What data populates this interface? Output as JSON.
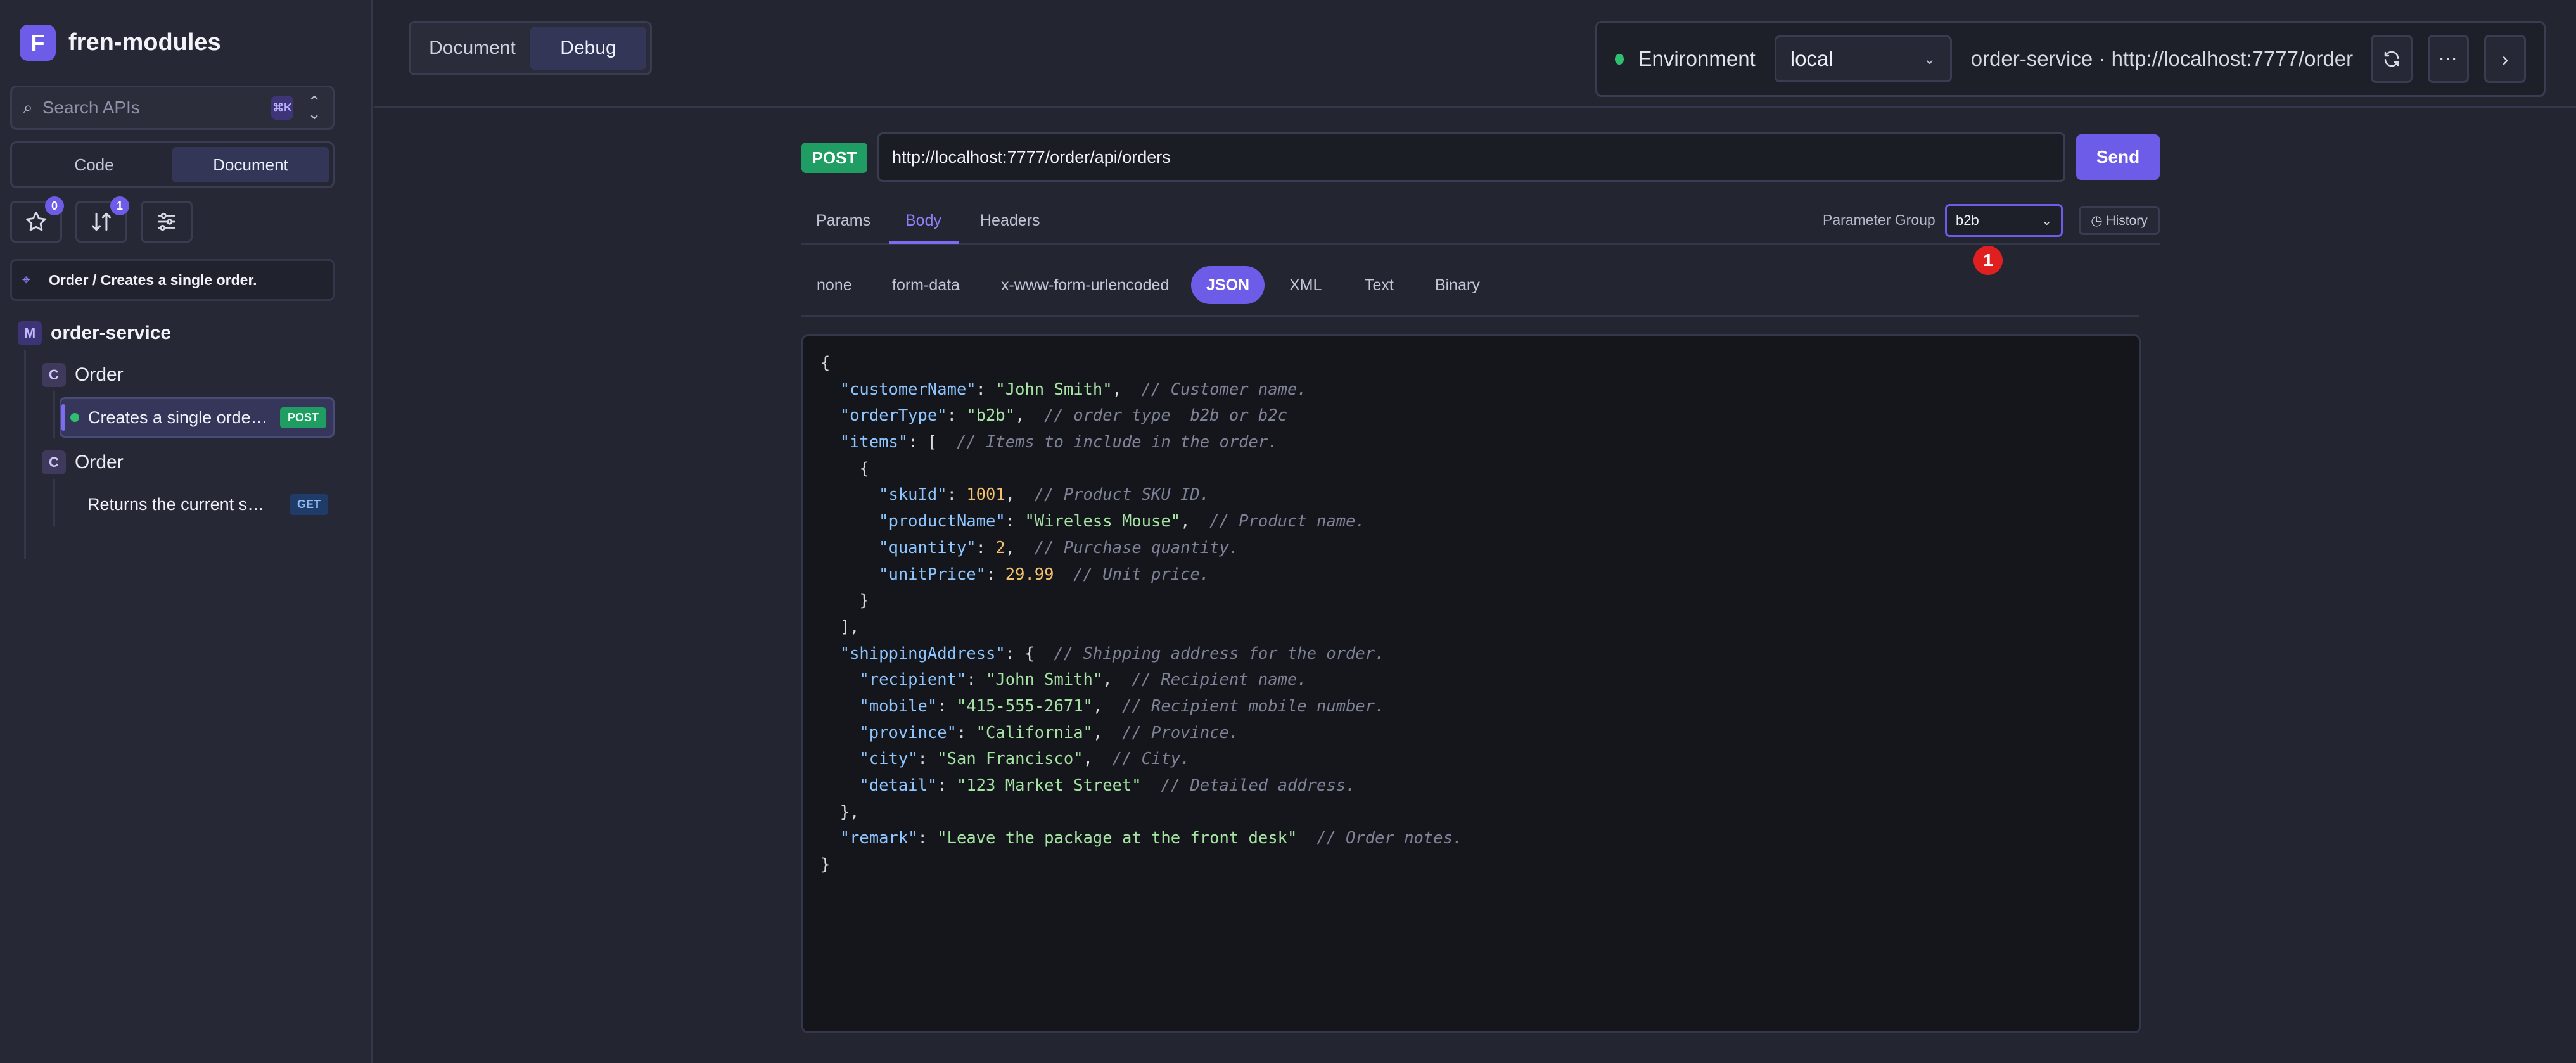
{
  "app": {
    "logo_letter": "F",
    "name": "fren-modules"
  },
  "sidebar": {
    "search": {
      "placeholder": "Search APIs",
      "shortcut": "⌘K"
    },
    "mode": {
      "options": [
        "Code",
        "Document"
      ],
      "active": "Document"
    },
    "tools": {
      "favorites_count": "0",
      "sort_count": "1"
    },
    "breadcrumb": "Order / Creates a single order.",
    "module": {
      "badge": "M",
      "name": "order-service"
    },
    "controllers": [
      {
        "badge": "C",
        "name": "Order",
        "endpoints": [
          {
            "name": "Creates a single orde…",
            "method": "POST",
            "active": true
          }
        ]
      },
      {
        "badge": "C",
        "name": "Order",
        "endpoints": [
          {
            "name": "Returns the current s…",
            "method": "GET",
            "active": false
          }
        ]
      }
    ]
  },
  "top": {
    "view_toggle": {
      "options": [
        "Document",
        "Debug"
      ],
      "active": "Debug"
    },
    "environment": {
      "label": "Environment",
      "selected": "local",
      "service_url": "order-service · http://localhost:7777/order"
    }
  },
  "request": {
    "method": "POST",
    "url": "http://localhost:7777/order/api/orders",
    "send_label": "Send",
    "tabs": [
      "Params",
      "Body",
      "Headers"
    ],
    "active_tab": "Body",
    "parameter_group": {
      "label": "Parameter Group",
      "selected": "b2b"
    },
    "history_label": "◷ History",
    "marker": "1",
    "body_types": [
      "none",
      "form-data",
      "x-www-form-urlencoded",
      "JSON",
      "XML",
      "Text",
      "Binary"
    ],
    "active_body_type": "JSON",
    "body_lines": [
      "{",
      "  \"customerName\": \"John Smith\",  // Customer name.",
      "  \"orderType\": \"b2b\",  // order type  b2b or b2c",
      "  \"items\": [  // Items to include in the order.",
      "    {",
      "      \"skuId\": 1001,  // Product SKU ID.",
      "      \"productName\": \"Wireless Mouse\",  // Product name.",
      "      \"quantity\": 2,  // Purchase quantity.",
      "      \"unitPrice\": 29.99  // Unit price.",
      "    }",
      "  ],",
      "  \"shippingAddress\": {  // Shipping address for the order.",
      "    \"recipient\": \"John Smith\",  // Recipient name.",
      "    \"mobile\": \"415-555-2671\",  // Recipient mobile number.",
      "    \"province\": \"California\",  // Province.",
      "    \"city\": \"San Francisco\",  // City.",
      "    \"detail\": \"123 Market Street\"  // Detailed address.",
      "  },",
      "  \"remark\": \"Leave the package at the front desk\"  // Order notes.",
      "}"
    ]
  },
  "colors": {
    "accent": "#6c5ce7",
    "post": "#1f9d63",
    "status_ok": "#2fbf71",
    "marker": "#e02020"
  }
}
